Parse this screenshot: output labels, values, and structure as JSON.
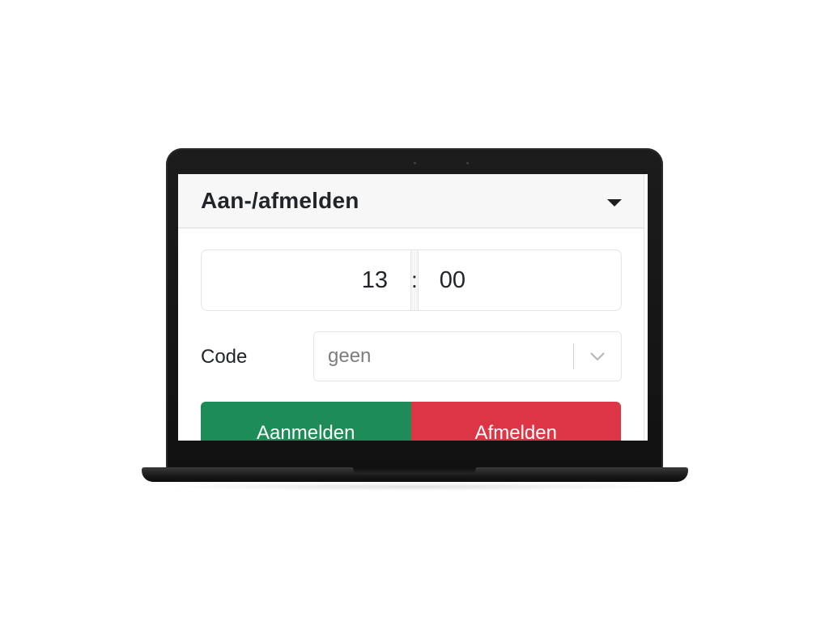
{
  "card": {
    "title": "Aan-/afmelden",
    "toggle_icon": "caret-down-icon"
  },
  "time": {
    "hours": "13",
    "separator": ":",
    "minutes": "00"
  },
  "code": {
    "label": "Code",
    "selected": "geen",
    "dropdown_icon": "chevron-down-icon"
  },
  "actions": {
    "sign_in_label": "Aanmelden",
    "sign_out_label": "Afmelden"
  },
  "colors": {
    "sign_in": "#1e8c56",
    "sign_out": "#dc3545",
    "header_bg": "#f7f7f7"
  }
}
